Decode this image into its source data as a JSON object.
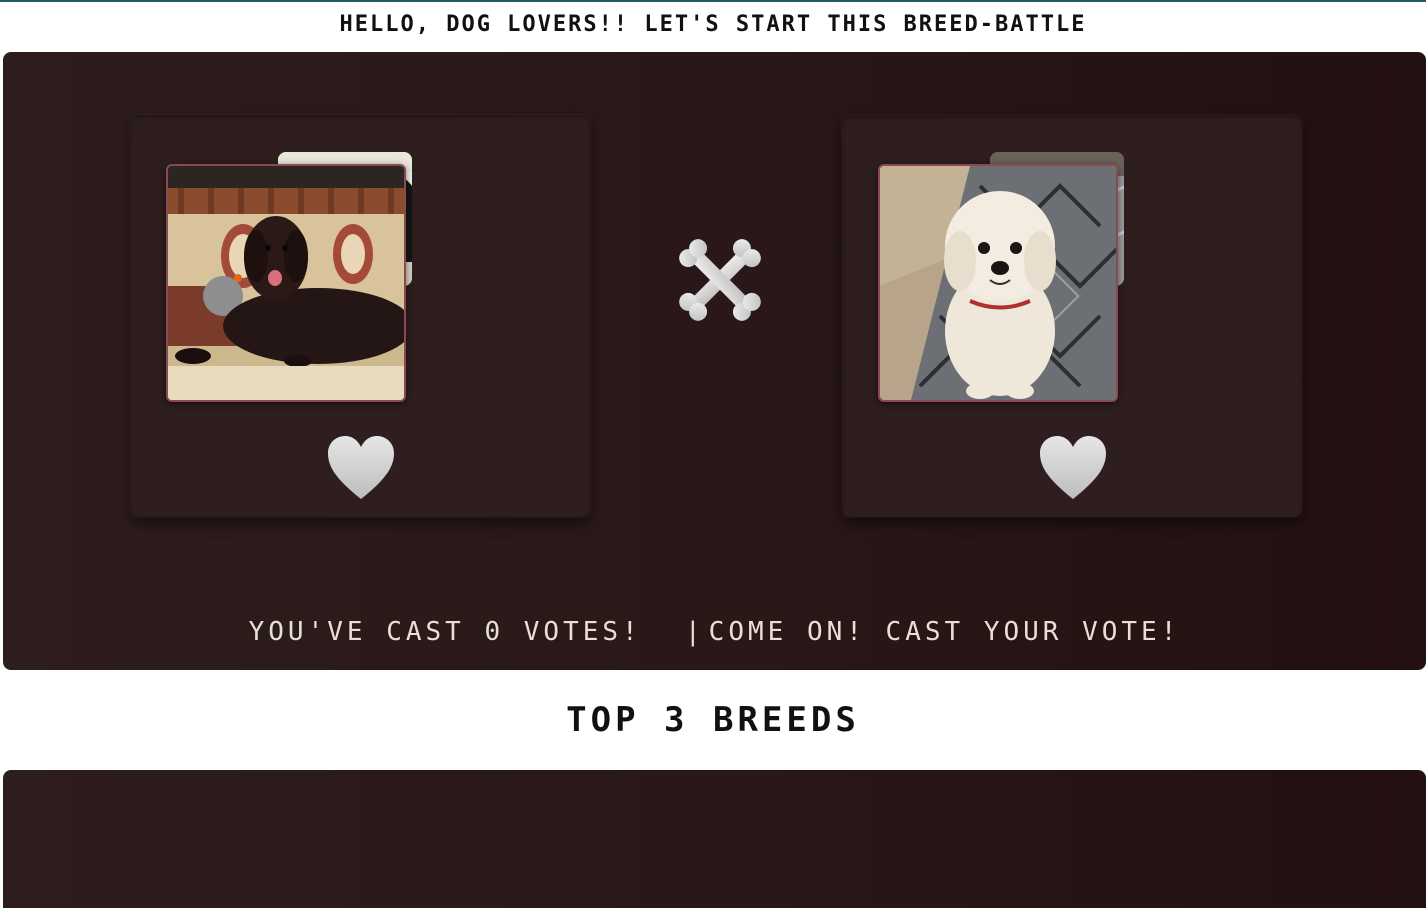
{
  "header": {
    "greeting": "Hello, Dog Lovers!! Let's start this breed-battle"
  },
  "battle": {
    "left_card": {
      "photo_front": "dark-brown-dog-on-sofa",
      "photo_back": "dog-partial-image",
      "vote_icon": "heart-icon"
    },
    "right_card": {
      "photo_front": "white-curly-dog-on-rug",
      "photo_back": "dog-partial-image",
      "vote_icon": "heart-icon"
    },
    "versus_icon": "crossed-bones-icon",
    "status": {
      "votes_text": "You've cast 0 votes!",
      "separator": "|",
      "prompt_text": "Come on! Cast your vote!"
    }
  },
  "leaderboard": {
    "title": "Top 3 Breeds"
  },
  "colors": {
    "panel_bg": "#2a1818",
    "card_bg": "#2e1e1f",
    "photo_border": "#8a4a50",
    "icon_fill": "#d9d9d9",
    "accent_line": "#1f5f63"
  }
}
